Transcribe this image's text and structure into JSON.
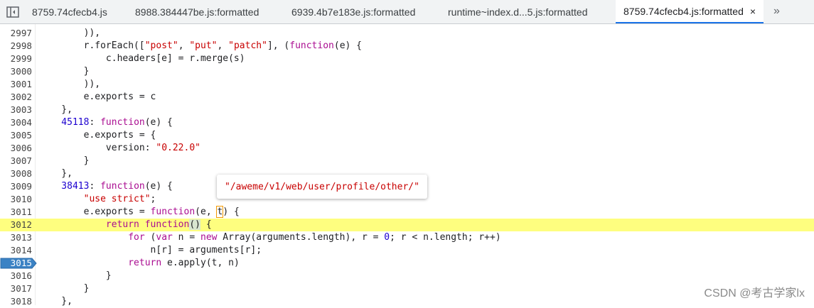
{
  "tabs": [
    {
      "label": "8759.74cfecb4.js",
      "active": false
    },
    {
      "label": "8988.384447be.js:formatted",
      "active": false
    },
    {
      "label": "6939.4b7e183e.js:formatted",
      "active": false
    },
    {
      "label": "runtime~index.d...5.js:formatted",
      "active": false
    },
    {
      "label": "8759.74cfecb4.js:formatted",
      "active": true
    }
  ],
  "tab_close_glyph": "×",
  "more_tabs_glyph": "»",
  "line_numbers": [
    "2997",
    "2998",
    "2999",
    "3000",
    "3001",
    "3002",
    "3003",
    "3004",
    "3005",
    "3006",
    "3007",
    "3008",
    "3009",
    "3010",
    "3011",
    "3012",
    "3013",
    "3014",
    "3015",
    "3016",
    "3017",
    "3018"
  ],
  "highlighted_line": "3012",
  "breakpoint_line": "3015",
  "tooltip": {
    "text": "\"/aweme/v1/web/user/profile/other/\""
  },
  "watermark": "CSDN @考古学家lx",
  "code": {
    "l2997": "        )),",
    "l2998_a": "        r.forEach([",
    "l2998_s1": "\"post\"",
    "l2998_b": ", ",
    "l2998_s2": "\"put\"",
    "l2998_c": ", ",
    "l2998_s3": "\"patch\"",
    "l2998_d": "], (",
    "l2998_kw": "function",
    "l2998_e": "(e) {",
    "l2999": "            c.headers[e] = r.merge(s)",
    "l3000": "        }",
    "l3001": "        )),",
    "l3002": "        e.exports = c",
    "l3003": "    },",
    "l3004_num": "    45118",
    "l3004_a": ": ",
    "l3004_kw": "function",
    "l3004_b": "(e) {",
    "l3005": "        e.exports = {",
    "l3006_a": "            version: ",
    "l3006_s": "\"0.22.0\"",
    "l3007": "        }",
    "l3008": "    },",
    "l3009_num": "    38413",
    "l3009_a": ": ",
    "l3009_kw": "function",
    "l3009_b": "(e) {",
    "l3010_s": "        \"use strict\"",
    "l3010_a": ";",
    "l3011_a": "        e.exports = ",
    "l3011_kw": "function",
    "l3011_b": "(e, ",
    "l3011_t": "t",
    "l3011_c": ") {",
    "l3012_kw1": "            return ",
    "l3012_kw2": "function",
    "l3012_p": "()",
    "l3012_a": " {",
    "l3013_a": "                ",
    "l3013_kw1": "for",
    "l3013_b": " (",
    "l3013_kw2": "var",
    "l3013_c": " n = ",
    "l3013_kw3": "new",
    "l3013_d": " Array(arguments.length), r = ",
    "l3013_num": "0",
    "l3013_e": "; r < n.length; r++)",
    "l3014": "                    n[r] = arguments[r];",
    "l3015_a": "                ",
    "l3015_kw": "return",
    "l3015_b": " e.apply(t, n)",
    "l3016": "            }",
    "l3017": "        }",
    "l3018": "    },"
  }
}
